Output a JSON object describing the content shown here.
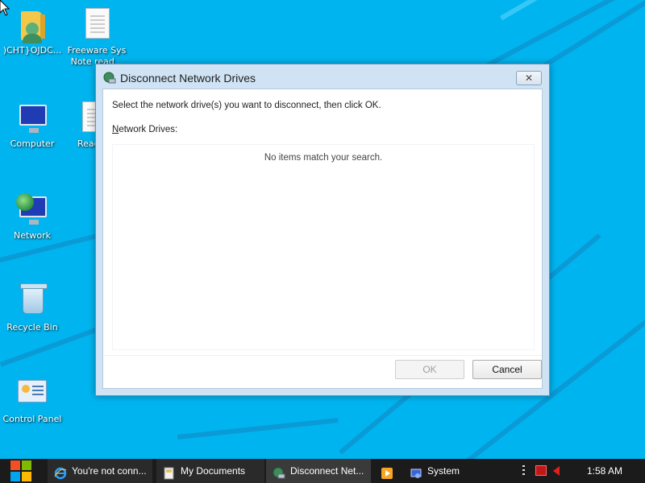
{
  "desktop": {
    "icons": [
      {
        "label": ")CHT}OJDC...",
        "icon": "user-folder-icon"
      },
      {
        "label": "Freeware Sys",
        "label2": "Note read...",
        "icon": "document-icon"
      },
      {
        "label": "Computer",
        "icon": "computer-icon"
      },
      {
        "label": "Read",
        "icon": "document-icon"
      },
      {
        "label": "Network",
        "icon": "network-icon"
      },
      {
        "label": "Recycle Bin",
        "icon": "recycle-bin-icon"
      },
      {
        "label": "Control Panel",
        "icon": "control-panel-icon"
      }
    ],
    "colors": {
      "background": "#00b4ef",
      "stripe": "#0a9ad6"
    }
  },
  "dialog": {
    "title": "Disconnect Network Drives",
    "close_label": "✕",
    "instruction": "Select the network drive(s) you want to disconnect, then click OK.",
    "drives_label_accel": "N",
    "drives_label_rest": "etwork Drives:",
    "empty_message": "No items match your search.",
    "ok_label": "OK",
    "cancel_label": "Cancel",
    "ok_enabled": false
  },
  "taskbar": {
    "tasks": [
      {
        "label": "You're not conn...",
        "icon": "internet-explorer-icon"
      },
      {
        "label": "My Documents",
        "icon": "folder-icon"
      },
      {
        "label": "Disconnect Net...",
        "icon": "network-drive-icon",
        "active": true
      },
      {
        "label": "",
        "icon": "media-player-icon"
      },
      {
        "label": "System",
        "icon": "system-icon"
      }
    ],
    "clock": "1:58 AM"
  }
}
